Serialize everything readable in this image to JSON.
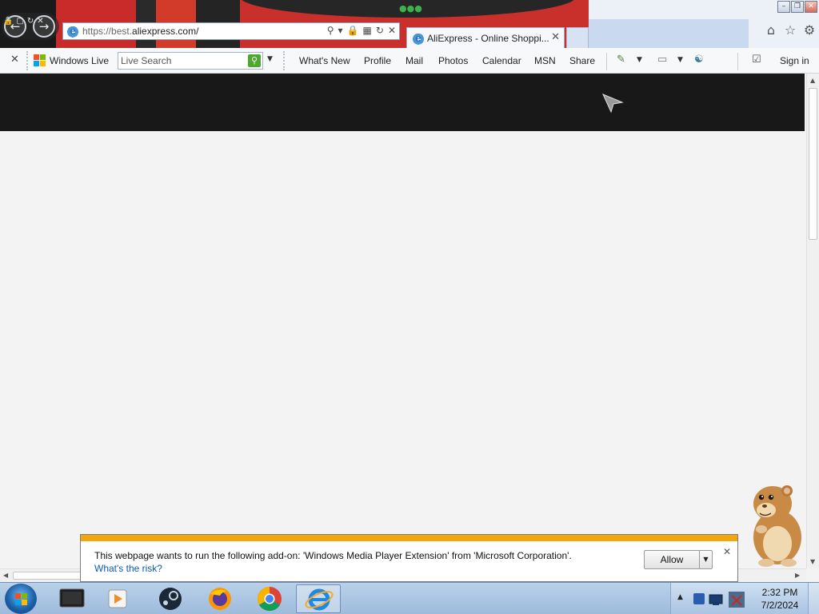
{
  "browser": {
    "url_prefix": "https://best.",
    "url_domain": "aliexpress.com/",
    "tab_title": "AliExpress - Online Shoppi...",
    "tab_close": "✕"
  },
  "window_controls": {
    "minimize": "–",
    "restore": "❐",
    "close": "✕"
  },
  "toolbar": {
    "close": "✕",
    "brand": "Windows Live",
    "search_placeholder": "Live Search",
    "links": [
      "What's New",
      "Profile",
      "Mail",
      "Photos",
      "Calendar",
      "MSN",
      "Share"
    ],
    "sign_in": "Sign in"
  },
  "notification": {
    "message": "This webpage wants to run the following add-on: 'Windows Media Player Extension' from 'Microsoft Corporation'.",
    "link": "What's the risk?",
    "allow_label": "Allow",
    "close": "✕"
  },
  "taskbar": {
    "clock_time": "2:32 PM",
    "clock_date": "7/2/2024"
  },
  "icons": {
    "back": "back-icon",
    "forward": "forward-icon",
    "search": "search-icon",
    "lock": "lock-icon",
    "refresh": "refresh-icon",
    "stop": "stop-icon",
    "home": "home-icon",
    "favorites": "star-icon",
    "tools": "gear-icon"
  },
  "colors": {
    "accent_red": "#d0272b",
    "notification_stripe": "#f2a80c",
    "link_blue": "#0b59b3",
    "header_dark": "#181818"
  }
}
